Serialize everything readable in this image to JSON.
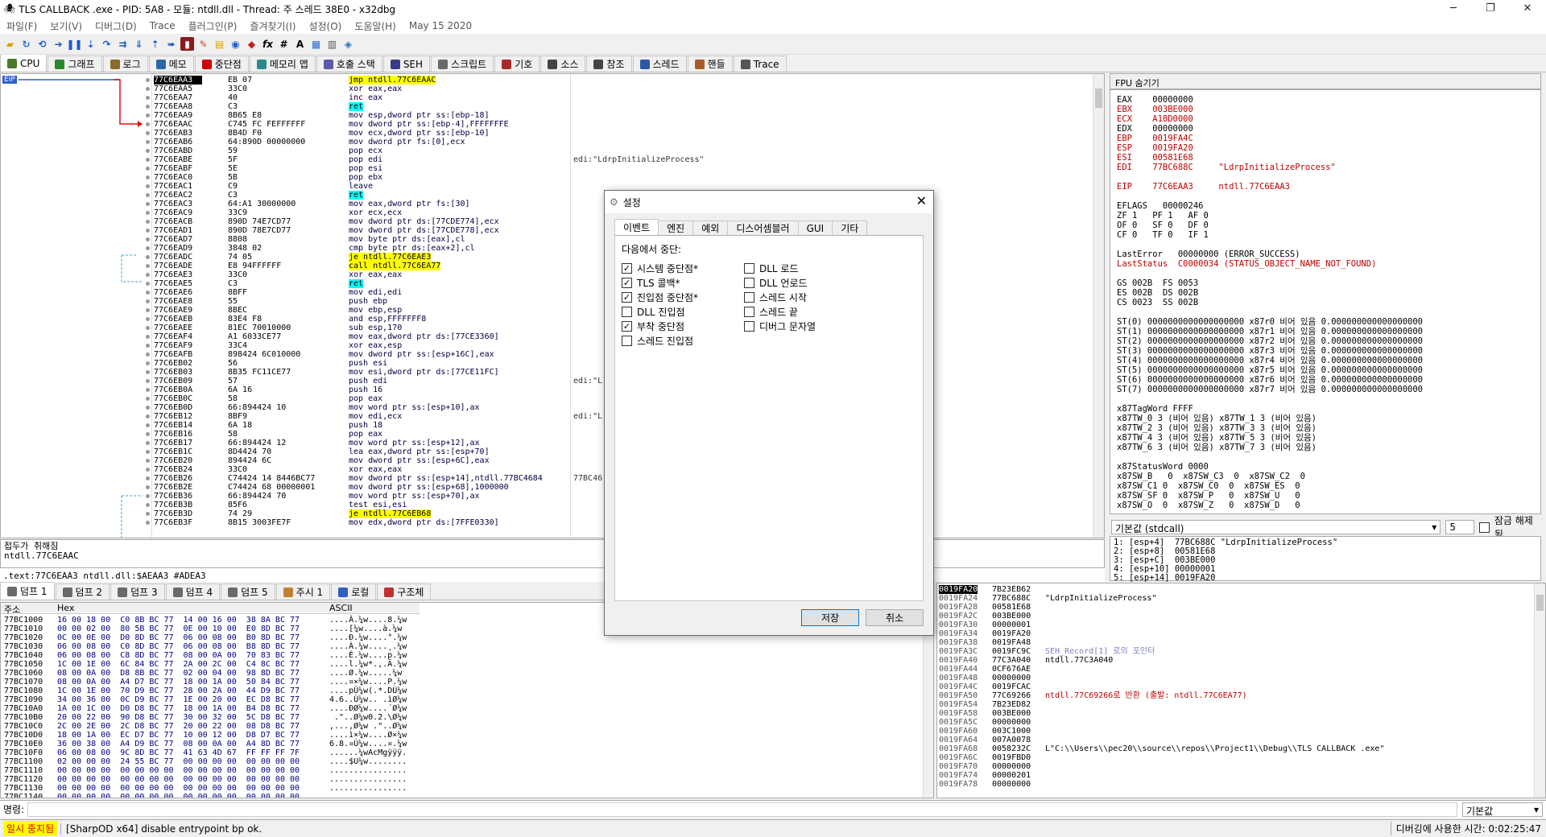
{
  "window": {
    "title": "TLS CALLBACK .exe - PID: 5A8 - 모듈: ntdll.dll - Thread: 주 스레드 38E0 - x32dbg"
  },
  "menu": [
    "파일(F)",
    "보기(V)",
    "디버그(D)",
    "Trace",
    "플러그인(P)",
    "즐겨찾기(I)",
    "설정(O)",
    "도움말(H)",
    "May 15 2020"
  ],
  "tabs": [
    {
      "label": "CPU",
      "color": "#4a7a2a"
    },
    {
      "label": "그래프",
      "color": "#2a8a2a"
    },
    {
      "label": "로그",
      "color": "#8a6a2a"
    },
    {
      "label": "메모",
      "color": "#2a6aaa"
    },
    {
      "label": "중단점",
      "color": "#cc0000"
    },
    {
      "label": "메모리 맵",
      "color": "#2a8a8a"
    },
    {
      "label": "호출 스택",
      "color": "#5a5aaa"
    },
    {
      "label": "SEH",
      "color": "#3a3a8a"
    },
    {
      "label": "스크립트",
      "color": "#6a6a6a"
    },
    {
      "label": "기호",
      "color": "#aa2a2a"
    },
    {
      "label": "소스",
      "color": "#444"
    },
    {
      "label": "참조",
      "color": "#444"
    },
    {
      "label": "스레드",
      "color": "#2a5aaa"
    },
    {
      "label": "핸들",
      "color": "#aa5a2a"
    },
    {
      "label": "Trace",
      "color": "#555"
    }
  ],
  "eip_label": "EIP",
  "disasm": [
    {
      "a": "77C6EAA3",
      "b": "EB 07",
      "i": "jmp ntdll.77C6EAAC",
      "c": "",
      "cur": true,
      "hl": "y"
    },
    {
      "a": "77C6EAA5",
      "b": "33C0",
      "i": "xor eax,eax",
      "c": ""
    },
    {
      "a": "77C6EAA7",
      "b": "40",
      "i": "inc eax",
      "c": ""
    },
    {
      "a": "77C6EAA8",
      "b": "C3",
      "i": "ret",
      "c": "",
      "hl": "c"
    },
    {
      "a": "77C6EAA9",
      "b": "8B65 E8",
      "i": "mov esp,dword ptr ss:[ebp-18]",
      "c": ""
    },
    {
      "a": "77C6EAAC",
      "b": "C745 FC FEFFFFFF",
      "i": "mov dword ptr ss:[ebp-4],FFFFFFFE",
      "c": ""
    },
    {
      "a": "77C6EAB3",
      "b": "8B4D F0",
      "i": "mov ecx,dword ptr ss:[ebp-10]",
      "c": ""
    },
    {
      "a": "77C6EAB6",
      "b": "64:890D 00000000",
      "i": "mov dword ptr fs:[0],ecx",
      "c": ""
    },
    {
      "a": "77C6EABD",
      "b": "59",
      "i": "pop ecx",
      "c": ""
    },
    {
      "a": "77C6EABE",
      "b": "5F",
      "i": "pop edi",
      "c": "edi:\"LdrpInitializeProcess\""
    },
    {
      "a": "77C6EABF",
      "b": "5E",
      "i": "pop esi",
      "c": ""
    },
    {
      "a": "77C6EAC0",
      "b": "5B",
      "i": "pop ebx",
      "c": ""
    },
    {
      "a": "77C6EAC1",
      "b": "C9",
      "i": "leave",
      "c": ""
    },
    {
      "a": "77C6EAC2",
      "b": "C3",
      "i": "ret",
      "c": "",
      "hl": "c"
    },
    {
      "a": "77C6EAC3",
      "b": "64:A1 30000000",
      "i": "mov eax,dword ptr fs:[30]",
      "c": ""
    },
    {
      "a": "77C6EAC9",
      "b": "33C9",
      "i": "xor ecx,ecx",
      "c": ""
    },
    {
      "a": "77C6EACB",
      "b": "890D 74E7CD77",
      "i": "mov dword ptr ds:[77CDE774],ecx",
      "c": ""
    },
    {
      "a": "77C6EAD1",
      "b": "890D 78E7CD77",
      "i": "mov dword ptr ds:[77CDE778],ecx",
      "c": ""
    },
    {
      "a": "77C6EAD7",
      "b": "8808",
      "i": "mov byte ptr ds:[eax],cl",
      "c": ""
    },
    {
      "a": "77C6EAD9",
      "b": "3848 02",
      "i": "cmp byte ptr ds:[eax+2],cl",
      "c": ""
    },
    {
      "a": "77C6EADC",
      "b": "74 05",
      "i": "je ntdll.77C6EAE3",
      "c": "",
      "hl": "y"
    },
    {
      "a": "77C6EADE",
      "b": "E8 94FFFFFF",
      "i": "call ntdll.77C6EA77",
      "c": "",
      "hl": "y"
    },
    {
      "a": "77C6EAE3",
      "b": "33C0",
      "i": "xor eax,eax",
      "c": ""
    },
    {
      "a": "77C6EAE5",
      "b": "C3",
      "i": "ret",
      "c": "",
      "hl": "c"
    },
    {
      "a": "77C6EAE6",
      "b": "8BFF",
      "i": "mov edi,edi",
      "c": ""
    },
    {
      "a": "77C6EAE8",
      "b": "55",
      "i": "push ebp",
      "c": ""
    },
    {
      "a": "77C6EAE9",
      "b": "8BEC",
      "i": "mov ebp,esp",
      "c": ""
    },
    {
      "a": "77C6EAEB",
      "b": "83E4 F8",
      "i": "and esp,FFFFFFF8",
      "c": ""
    },
    {
      "a": "77C6EAEE",
      "b": "81EC 70010000",
      "i": "sub esp,170",
      "c": ""
    },
    {
      "a": "77C6EAF4",
      "b": "A1 6033CE77",
      "i": "mov eax,dword ptr ds:[77CE3360]",
      "c": ""
    },
    {
      "a": "77C6EAF9",
      "b": "33C4",
      "i": "xor eax,esp",
      "c": ""
    },
    {
      "a": "77C6EAFB",
      "b": "898424 6C010000",
      "i": "mov dword ptr ss:[esp+16C],eax",
      "c": ""
    },
    {
      "a": "77C6EB02",
      "b": "56",
      "i": "push esi",
      "c": ""
    },
    {
      "a": "77C6EB03",
      "b": "8B35 FC11CE77",
      "i": "mov esi,dword ptr ds:[77CE11FC]",
      "c": ""
    },
    {
      "a": "77C6EB09",
      "b": "57",
      "i": "push edi",
      "c": "edi:\"L"
    },
    {
      "a": "77C6EB0A",
      "b": "6A 16",
      "i": "push 16",
      "c": ""
    },
    {
      "a": "77C6EB0C",
      "b": "58",
      "i": "pop eax",
      "c": ""
    },
    {
      "a": "77C6EB0D",
      "b": "66:894424 10",
      "i": "mov word ptr ss:[esp+10],ax",
      "c": ""
    },
    {
      "a": "77C6EB12",
      "b": "8BF9",
      "i": "mov edi,ecx",
      "c": "edi:\"L"
    },
    {
      "a": "77C6EB14",
      "b": "6A 18",
      "i": "push 18",
      "c": ""
    },
    {
      "a": "77C6EB16",
      "b": "58",
      "i": "pop eax",
      "c": ""
    },
    {
      "a": "77C6EB17",
      "b": "66:894424 12",
      "i": "mov word ptr ss:[esp+12],ax",
      "c": ""
    },
    {
      "a": "77C6EB1C",
      "b": "8D4424 70",
      "i": "lea eax,dword ptr ss:[esp+70]",
      "c": ""
    },
    {
      "a": "77C6EB20",
      "b": "894424 6C",
      "i": "mov dword ptr ss:[esp+6C],eax",
      "c": ""
    },
    {
      "a": "77C6EB24",
      "b": "33C0",
      "i": "xor eax,eax",
      "c": ""
    },
    {
      "a": "77C6EB26",
      "b": "C74424 14 8446BC77",
      "i": "mov dword ptr ss:[esp+14],ntdll.77BC4684",
      "c": "77BC46"
    },
    {
      "a": "77C6EB2E",
      "b": "C74424 68 00000001",
      "i": "mov dword ptr ss:[esp+68],1000000",
      "c": ""
    },
    {
      "a": "77C6EB36",
      "b": "66:894424 70",
      "i": "mov word ptr ss:[esp+70],ax",
      "c": ""
    },
    {
      "a": "77C6EB3B",
      "b": "85F6",
      "i": "test esi,esi",
      "c": ""
    },
    {
      "a": "77C6EB3D",
      "b": "74 29",
      "i": "je ntdll.77C6EB68",
      "c": "",
      "hl": "y"
    },
    {
      "a": "77C6EB3F",
      "b": "8B15 3003FE7F",
      "i": "mov edx,dword ptr ds:[7FFE0330]",
      "c": ""
    }
  ],
  "disasm_info": {
    "line1": "접두가 취해짐",
    "line2": "ntdll.77C6EAAC",
    "line3": ".text:77C6EAA3 ntdll.dll:$AEAA3 #ADEA3"
  },
  "fpu_header": "FPU 숨기기",
  "registers": [
    {
      "t": "EAX    00000000",
      "c": "#000"
    },
    {
      "t": "EBX    003BE000",
      "c": "#c00000"
    },
    {
      "t": "ECX    A18D0000",
      "c": "#c00000"
    },
    {
      "t": "EDX    00000000",
      "c": "#000"
    },
    {
      "t": "EBP    0019FA4C",
      "c": "#c00000"
    },
    {
      "t": "ESP    0019FA20",
      "c": "#c00000"
    },
    {
      "t": "ESI    00581E68",
      "c": "#c00000"
    },
    {
      "t": "EDI    77BC688C     \"LdrpInitializeProcess\"",
      "c": "#c00000"
    },
    {
      "t": "",
      "c": "#000"
    },
    {
      "t": "EIP    77C6EAA3     ntdll.77C6EAA3",
      "c": "#c00000"
    },
    {
      "t": "",
      "c": "#000"
    },
    {
      "t": "EFLAGS   00000246",
      "c": "#000"
    },
    {
      "t": "ZF 1   PF 1   AF 0",
      "c": "#000"
    },
    {
      "t": "OF 0   SF 0   DF 0",
      "c": "#000"
    },
    {
      "t": "CF 0   TF 0   IF 1",
      "c": "#000"
    },
    {
      "t": "",
      "c": "#000"
    },
    {
      "t": "LastError   00000000 (ERROR_SUCCESS)",
      "c": "#000"
    },
    {
      "t": "LastStatus  C0000034 (STATUS_OBJECT_NAME_NOT_FOUND)",
      "c": "#c00000"
    },
    {
      "t": "",
      "c": "#000"
    },
    {
      "t": "GS 002B  FS 0053",
      "c": "#000"
    },
    {
      "t": "ES 002B  DS 002B",
      "c": "#000"
    },
    {
      "t": "CS 0023  SS 002B",
      "c": "#000"
    },
    {
      "t": "",
      "c": "#000"
    },
    {
      "t": "ST(0) 0000000000000000000 x87r0 비어 있음 0.000000000000000000",
      "c": "#000"
    },
    {
      "t": "ST(1) 0000000000000000000 x87r1 비어 있음 0.000000000000000000",
      "c": "#000"
    },
    {
      "t": "ST(2) 0000000000000000000 x87r2 비어 있음 0.000000000000000000",
      "c": "#000"
    },
    {
      "t": "ST(3) 0000000000000000000 x87r3 비어 있음 0.000000000000000000",
      "c": "#000"
    },
    {
      "t": "ST(4) 0000000000000000000 x87r4 비어 있음 0.000000000000000000",
      "c": "#000"
    },
    {
      "t": "ST(5) 0000000000000000000 x87r5 비어 있음 0.000000000000000000",
      "c": "#000"
    },
    {
      "t": "ST(6) 0000000000000000000 x87r6 비어 있음 0.000000000000000000",
      "c": "#000"
    },
    {
      "t": "ST(7) 0000000000000000000 x87r7 비어 있음 0.000000000000000000",
      "c": "#000"
    },
    {
      "t": "",
      "c": "#000"
    },
    {
      "t": "x87TagWord FFFF",
      "c": "#000"
    },
    {
      "t": "x87TW_0 3 (비어 있음) x87TW_1 3 (비어 있음)",
      "c": "#000"
    },
    {
      "t": "x87TW_2 3 (비어 있음) x87TW_3 3 (비어 있음)",
      "c": "#000"
    },
    {
      "t": "x87TW_4 3 (비어 있음) x87TW_5 3 (비어 있음)",
      "c": "#000"
    },
    {
      "t": "x87TW_6 3 (비어 있음) x87TW_7 3 (비어 있음)",
      "c": "#000"
    },
    {
      "t": "",
      "c": "#000"
    },
    {
      "t": "x87StatusWord 0000",
      "c": "#000"
    },
    {
      "t": "x87SW_B   0  x87SW_C3  0  x87SW_C2  0",
      "c": "#000"
    },
    {
      "t": "x87SW_C1 0  x87SW_C0  0  x87SW_ES  0",
      "c": "#000"
    },
    {
      "t": "x87SW_SF 0  x87SW_P   0  x87SW_U   0",
      "c": "#000"
    },
    {
      "t": "x87SW_O  0  x87SW_Z   0  x87SW_D   0",
      "c": "#000"
    }
  ],
  "callconv": {
    "label": "기본값 (stdcall)",
    "count": "5",
    "unlock": "잠금 해제됨"
  },
  "stack_args": [
    "1: [esp+4]  77BC688C \"LdrpInitializeProcess\"",
    "2: [esp+8]  00581E68",
    "3: [esp+C]  003BE000",
    "4: [esp+10] 00000001",
    "5: [esp+14] 0019FA20"
  ],
  "dump_tabs": [
    "덤프 1",
    "덤프 2",
    "덤프 3",
    "덤프 4",
    "덤프 5",
    "주시 1",
    "로컬",
    "구조체"
  ],
  "dump_headers": {
    "addr": "주소",
    "hex": "Hex",
    "ascii": "ASCII"
  },
  "dump": [
    {
      "a": "77BC1000",
      "h": "16 00 18 00  C0 8B BC 77  14 00 16 00  38 8A BC 77",
      "s": "....À.¼w....8.¼w"
    },
    {
      "a": "77BC1010",
      "h": "00 00 02 00  80 5B BC 77  0E 00 10 00  E0 8D BC 77",
      "s": "....[¼w....à.¼w"
    },
    {
      "a": "77BC1020",
      "h": "0C 00 0E 00  D0 8D BC 77  06 00 08 00  B0 8D BC 77",
      "s": "....Ð.¼w....°.¼w"
    },
    {
      "a": "77BC1030",
      "h": "06 00 08 00  C0 8D BC 77  06 00 08 00  B8 8D BC 77",
      "s": "....À.¼w....¸.¼w"
    },
    {
      "a": "77BC1040",
      "h": "06 00 08 00  C8 8D BC 77  08 00 0A 00  70 83 BC 77",
      "s": "....È.¼w....p.¼w"
    },
    {
      "a": "77BC1050",
      "h": "1C 00 1E 00  6C 84 BC 77  2A 00 2C 00  C4 8C BC 77",
      "s": "....l.¼w*.,.Ä.¼w"
    },
    {
      "a": "77BC1060",
      "h": "08 00 0A 00  D8 8B BC 77  02 00 04 00  98 8D BC 77",
      "s": "....Ø.¼w.....¼w"
    },
    {
      "a": "77BC1070",
      "h": "08 00 0A 00  A4 D7 BC 77  18 00 1A 00  50 84 BC 77",
      "s": "....¤×¼w....P.¼w"
    },
    {
      "a": "77BC1080",
      "h": "1C 00 1E 00  70 D9 BC 77  28 00 2A 00  44 D9 BC 77",
      "s": "....pÙ¼w(.*.DÙ¼w"
    },
    {
      "a": "77BC1090",
      "h": "34 00 36 00  0C D9 BC 77  1E 00 20 00  EC D8 BC 77",
      "s": "4.6..Ù¼w.. .ìØ¼w"
    },
    {
      "a": "77BC10A0",
      "h": "1A 00 1C 00  D0 D8 BC 77  18 00 1A 00  B4 D8 BC 77",
      "s": "....ÐØ¼w....´Ø¼w"
    },
    {
      "a": "77BC10B0",
      "h": "20 00 22 00  90 D8 BC 77  30 00 32 00  5C D8 BC 77",
      "s": " .\"..Ø¼w0.2.\\Ø¼w"
    },
    {
      "a": "77BC10C0",
      "h": "2C 00 2E 00  2C D8 BC 77  20 00 22 00  08 D8 BC 77",
      "s": ",...,Ø¼w .\"..Ø¼w"
    },
    {
      "a": "77BC10D0",
      "h": "18 00 1A 00  EC D7 BC 77  10 00 12 00  D8 D7 BC 77",
      "s": "....ì×¼w....Ø×¼w"
    },
    {
      "a": "77BC10E0",
      "h": "36 00 38 00  A4 D9 BC 77  08 00 0A 00  A4 8D BC 77",
      "s": "6.8.¤Ù¼w....¤.¼w"
    },
    {
      "a": "77BC10F0",
      "h": "06 00 08 00  9C 8D BC 77  41 63 4D 67  FF FF FF 7F",
      "s": "......¼wAcMgÿÿÿ."
    },
    {
      "a": "77BC1100",
      "h": "02 00 00 00  24 55 BC 77  00 00 00 00  00 00 00 00",
      "s": "....$U¼w........"
    },
    {
      "a": "77BC1110",
      "h": "00 00 00 00  00 00 00 00  00 00 00 00  00 00 00 00",
      "s": "................"
    },
    {
      "a": "77BC1120",
      "h": "00 00 00 00  00 00 00 00  00 00 00 00  00 00 00 00",
      "s": "................"
    },
    {
      "a": "77BC1130",
      "h": "00 00 00 00  00 00 00 00  00 00 00 00  00 00 00 00",
      "s": "................"
    },
    {
      "a": "77BC1140",
      "h": "00 00 00 00  00 00 00 00  00 00 00 00  00 00 00 00",
      "s": "................"
    }
  ],
  "stack": [
    {
      "a": "0019FA20",
      "v": "7B23EB62",
      "c": "",
      "cur": true
    },
    {
      "a": "0019FA24",
      "v": "77BC688C",
      "c": "\"LdrpInitializeProcess\""
    },
    {
      "a": "0019FA28",
      "v": "00581E68",
      "c": ""
    },
    {
      "a": "0019FA2C",
      "v": "003BE000",
      "c": ""
    },
    {
      "a": "0019FA30",
      "v": "00000001",
      "c": ""
    },
    {
      "a": "0019FA34",
      "v": "0019FA20",
      "c": ""
    },
    {
      "a": "0019FA38",
      "v": "0019FA48",
      "c": ""
    },
    {
      "a": "0019FA3C",
      "v": "0019FC9C",
      "c": "SEH_Record[1] 로의 포인터",
      "col": "#8080c0"
    },
    {
      "a": "0019FA40",
      "v": "77C3A040",
      "c": "ntdll.77C3A040"
    },
    {
      "a": "0019FA44",
      "v": "0CF676AE",
      "c": ""
    },
    {
      "a": "0019FA48",
      "v": "00000000",
      "c": ""
    },
    {
      "a": "0019FA4C",
      "v": "0019FCAC",
      "c": ""
    },
    {
      "a": "0019FA50",
      "v": "77C69266",
      "c": "ntdll.77C69266로 반환 (출발: ntdll.77C6EA77)",
      "col": "#c00000"
    },
    {
      "a": "0019FA54",
      "v": "7B23ED82",
      "c": ""
    },
    {
      "a": "0019FA58",
      "v": "003BE000",
      "c": ""
    },
    {
      "a": "0019FA5C",
      "v": "00000000",
      "c": ""
    },
    {
      "a": "0019FA60",
      "v": "003C1000",
      "c": ""
    },
    {
      "a": "0019FA64",
      "v": "007A0078",
      "c": ""
    },
    {
      "a": "0019FA68",
      "v": "0058232C",
      "c": "L\"C:\\\\Users\\\\pec20\\\\source\\\\repos\\\\Project1\\\\Debug\\\\TLS CALLBACK .exe\""
    },
    {
      "a": "0019FA6C",
      "v": "0019FBD0",
      "c": ""
    },
    {
      "a": "0019FA70",
      "v": "00000000",
      "c": ""
    },
    {
      "a": "0019FA74",
      "v": "00000201",
      "c": ""
    },
    {
      "a": "0019FA78",
      "v": "00000000",
      "c": ""
    }
  ],
  "cmd": {
    "label": "명령:",
    "right": "기본값"
  },
  "status": {
    "paused": "일시 중지됨",
    "message": "[SharpOD x64] disable entrypoint bp ok.",
    "time": "디버깅에 사용한 시간: 0:02:25:47"
  },
  "dialog": {
    "title": "설정",
    "tabs": [
      "이벤트",
      "엔진",
      "예외",
      "디스어셈블러",
      "GUI",
      "기타"
    ],
    "section": "다음에서 중단:",
    "left": [
      {
        "label": "시스템 중단점*",
        "checked": true
      },
      {
        "label": "TLS 콜백*",
        "checked": true
      },
      {
        "label": "진입점 중단점*",
        "checked": true
      },
      {
        "label": "DLL 진입점",
        "checked": false
      },
      {
        "label": "부착 중단점",
        "checked": true
      },
      {
        "label": "스레드 진입점",
        "checked": false
      }
    ],
    "right": [
      {
        "label": "DLL 로드",
        "checked": false
      },
      {
        "label": "DLL 언로드",
        "checked": false
      },
      {
        "label": "스레드 시작",
        "checked": false
      },
      {
        "label": "스레드 끝",
        "checked": false
      },
      {
        "label": "디버그 문자열",
        "checked": false
      }
    ],
    "save": "저장",
    "cancel": "취소"
  }
}
